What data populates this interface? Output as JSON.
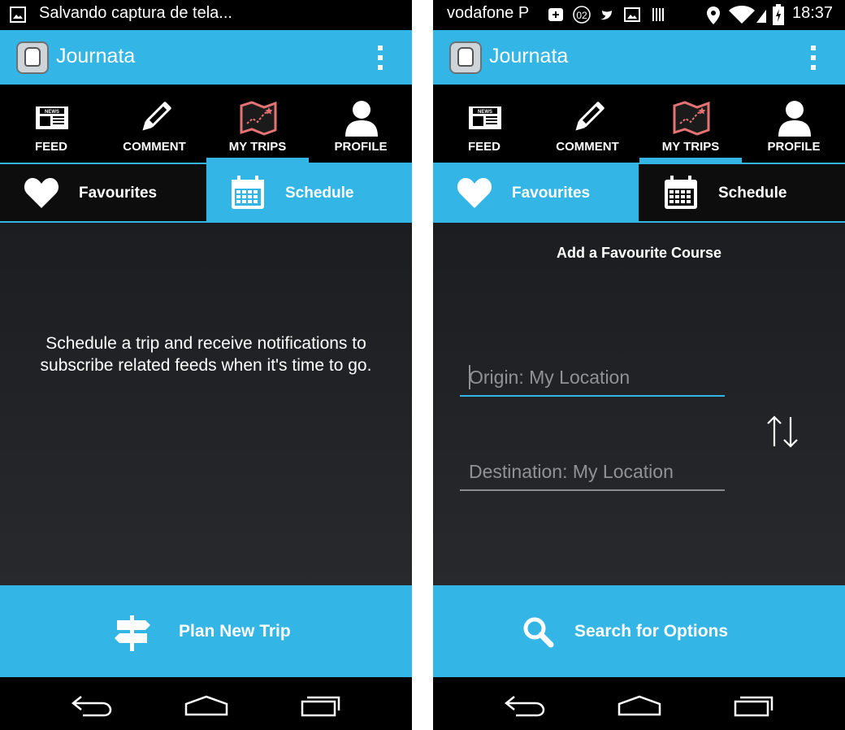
{
  "app_title": "Journata",
  "nav_tabs": [
    {
      "label": "FEED",
      "icon": "newspaper-icon"
    },
    {
      "label": "COMMENT",
      "icon": "pencil-icon"
    },
    {
      "label": "MY TRIPS",
      "icon": "map-icon"
    },
    {
      "label": "PROFILE",
      "icon": "user-icon"
    }
  ],
  "sub_tabs": [
    {
      "label": "Favourites",
      "icon": "heart-icon"
    },
    {
      "label": "Schedule",
      "icon": "calendar-icon"
    }
  ],
  "left": {
    "status_text": "Salvando captura de tela...",
    "active_nav": "MY TRIPS",
    "active_sub_tab": "Schedule",
    "message": "Schedule a trip and receive notifications to subscribe related feeds when it's time to go.",
    "bottom_button": {
      "label": "Plan New Trip",
      "icon": "signpost-icon"
    }
  },
  "right": {
    "carrier": "vodafone P",
    "clock": "18:37",
    "active_nav": "MY TRIPS",
    "active_sub_tab": "Favourites",
    "title": "Add a Favourite Course",
    "origin_placeholder": "Origin: My Location",
    "destination_placeholder": "Destination: My Location",
    "bottom_button": {
      "label": "Search for Options",
      "icon": "search-icon"
    }
  },
  "colors": {
    "accent": "#33b5e5",
    "background": "#1b1c1f",
    "tabbar": "#000000",
    "map_icon": "#e57373"
  }
}
